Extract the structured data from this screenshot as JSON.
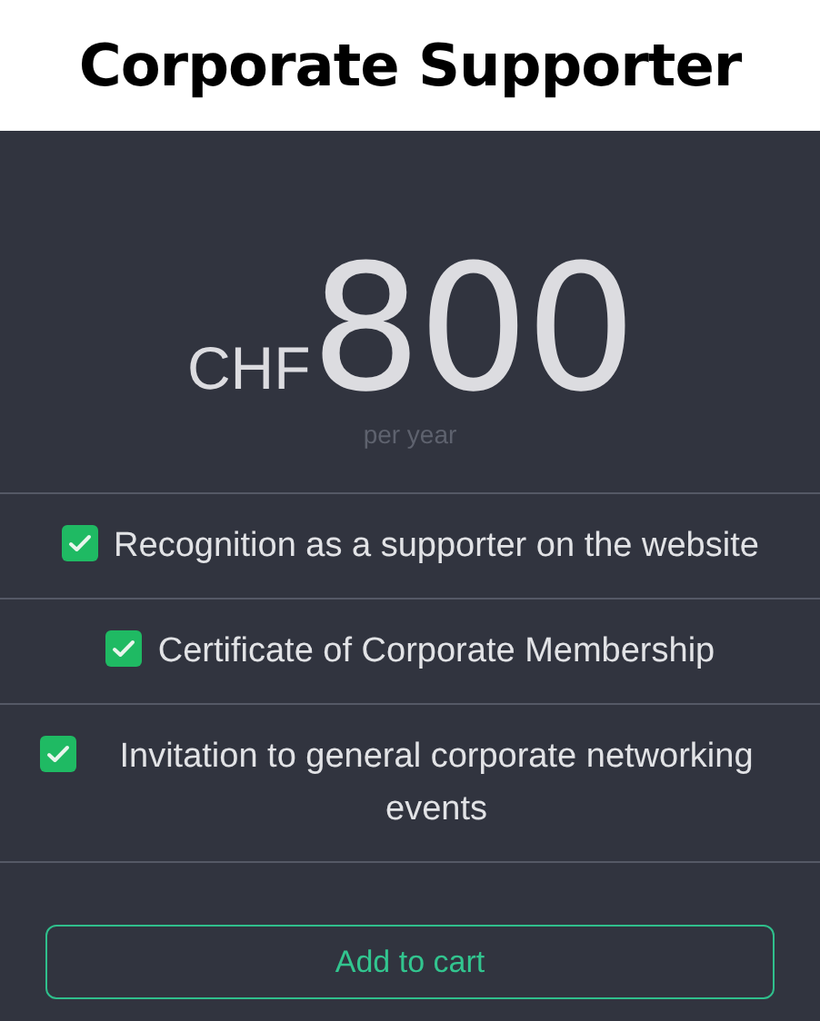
{
  "title": "Corporate Supporter",
  "price": {
    "currency": "CHF",
    "amount": "800",
    "period": "per year"
  },
  "features": [
    {
      "text": "Recognition as a supporter on the website"
    },
    {
      "text": "Certificate of Corporate Membership"
    },
    {
      "text": "Invitation to general corporate networking events"
    }
  ],
  "button": "Add to cart"
}
